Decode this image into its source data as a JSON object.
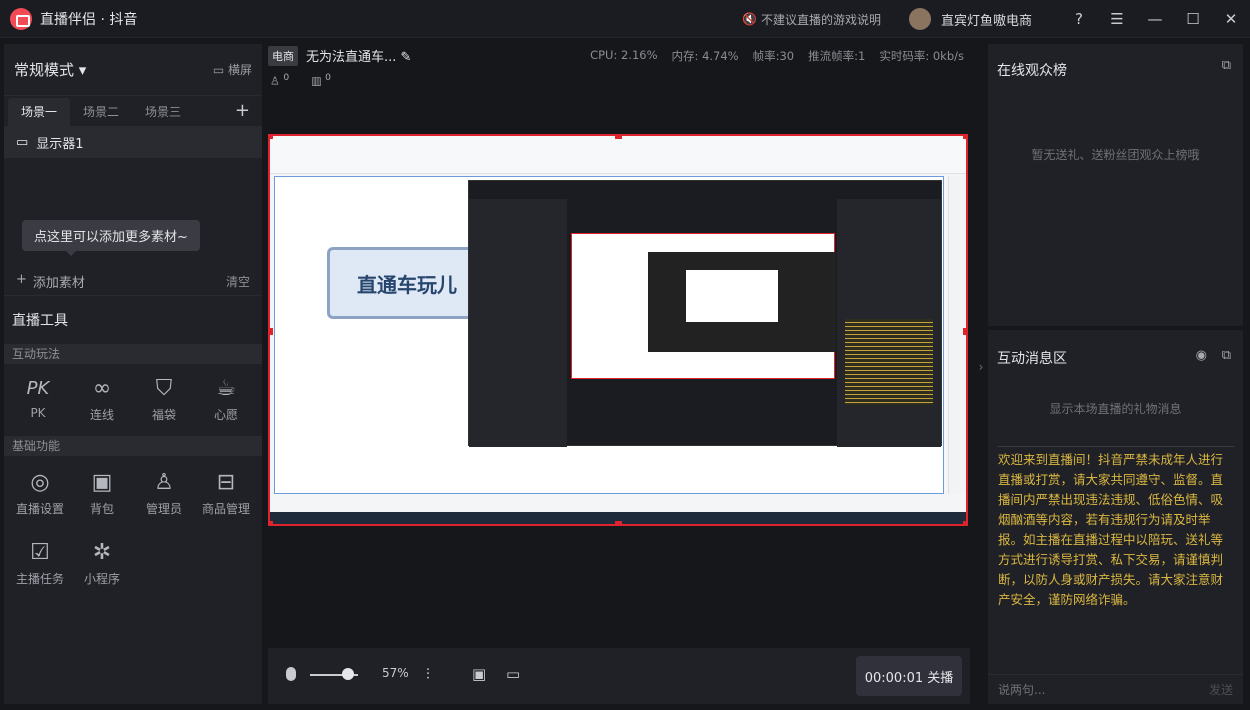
{
  "app": {
    "name": "直播伴侣 · 抖音",
    "help_link": "不建议直播的游戏说明",
    "user": "直宾灯鱼嗷电商"
  },
  "left": {
    "mode": "常规模式 ▾",
    "landscape": "横屏",
    "scene_tabs": [
      "场景一",
      "场景二",
      "场景三"
    ],
    "source": "显示器1",
    "tooltip": "点这里可以添加更多素材~",
    "add_source": "添加素材",
    "clear": "清空",
    "tools_title": "直播工具",
    "interactive_section": "互动玩法",
    "interactive_tools": [
      {
        "icon": "PK",
        "label": "PK"
      },
      {
        "icon": "∞",
        "label": "连线"
      },
      {
        "icon": "⛉",
        "label": "福袋"
      },
      {
        "icon": "☕",
        "label": "心愿"
      }
    ],
    "basic_section": "基础功能",
    "basic_tools": [
      {
        "icon": "◎",
        "label": "直播设置"
      },
      {
        "icon": "▣",
        "label": "背包"
      },
      {
        "icon": "♙",
        "label": "管理员"
      },
      {
        "icon": "⊟",
        "label": "商品管理"
      },
      {
        "icon": "☑",
        "label": "主播任务"
      },
      {
        "icon": "✲",
        "label": "小程序"
      }
    ]
  },
  "stage": {
    "category": "电商",
    "title": "无为法直通车...",
    "cpu": "CPU: 2.16%",
    "mem": "内存: 4.74%",
    "fps": "帧率:30",
    "push_fps": "推流帧率:1",
    "bitrate": "实时码率: 0kb/s",
    "viewers": "0",
    "gifts": "0",
    "mind_node": "直通车玩儿"
  },
  "controls": {
    "volume": "57%",
    "timer_btn": "00:00:01 关播"
  },
  "right": {
    "viewers_title": "在线观众榜",
    "viewers_empty": "暂无送礼、送粉丝团观众上榜哦",
    "messages_title": "互动消息区",
    "gift_hint": "显示本场直播的礼物消息",
    "notice": "欢迎来到直播间！抖音严禁未成年人进行直播或打赏，请大家共同遵守、监督。直播间内严禁出现违法违规、低俗色情、吸烟酗酒等内容，若有违规行为请及时举报。如主播在直播过程中以陪玩、送礼等方式进行诱导打赏、私下交易，请谨慎判断，以防人身或财产损失。请大家注意财产安全，谨防网络诈骗。",
    "chat_placeholder": "说两句...",
    "send": "发送"
  }
}
